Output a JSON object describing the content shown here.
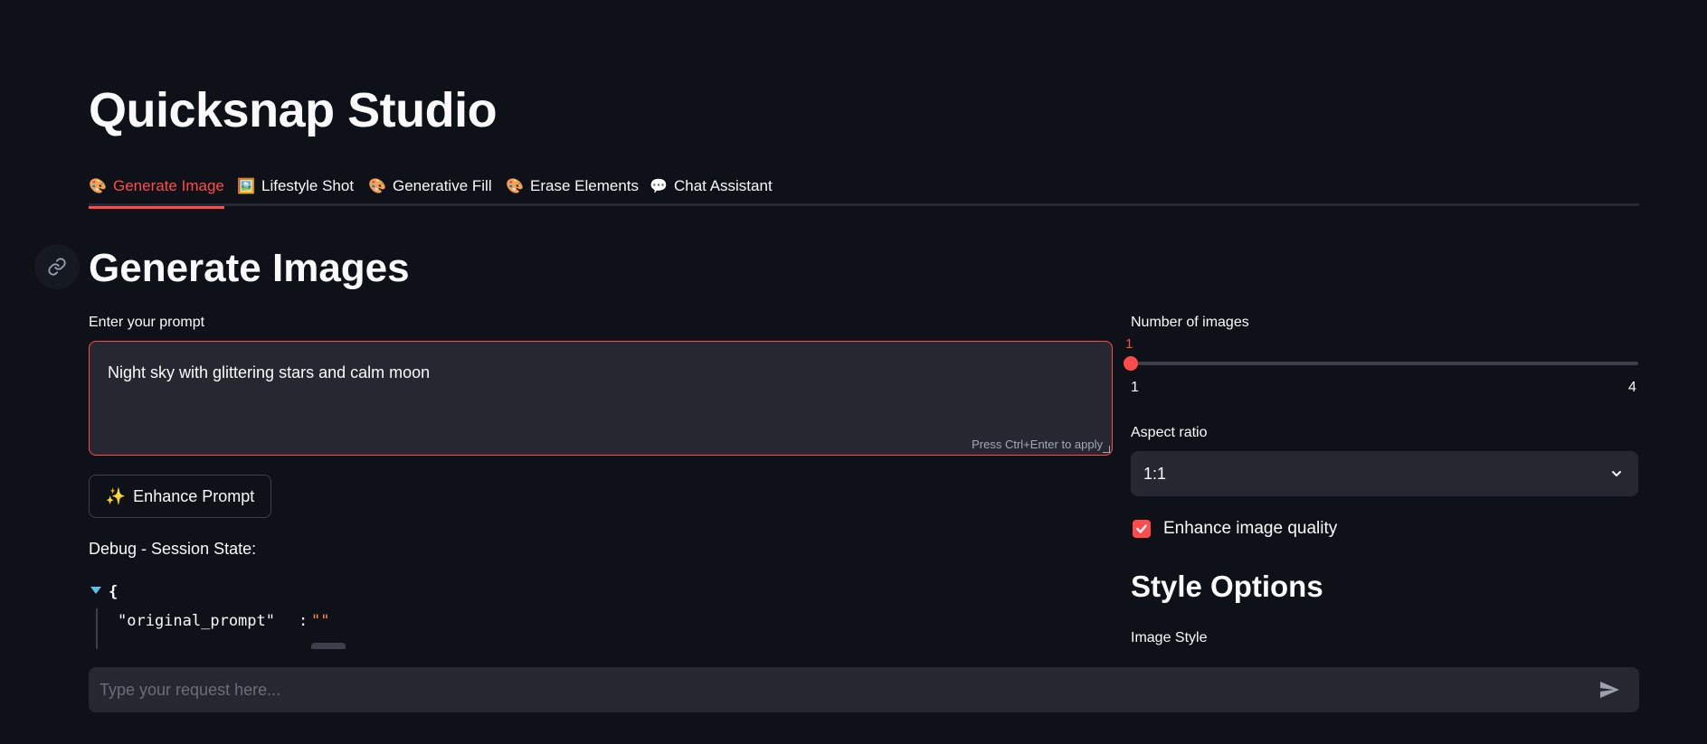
{
  "app": {
    "title": "Quicksnap Studio"
  },
  "tabs": [
    {
      "icon": "🎨",
      "label": "Generate Image",
      "active": true
    },
    {
      "icon": "🖼️",
      "label": "Lifestyle Shot"
    },
    {
      "icon": "🎨",
      "label": "Generative Fill"
    },
    {
      "icon": "🎨",
      "label": "Erase Elements"
    },
    {
      "icon": "💬",
      "label": "Chat Assistant"
    }
  ],
  "section": {
    "title": "Generate Images",
    "anchor_icon": "link-icon"
  },
  "prompt": {
    "label": "Enter your prompt",
    "value": "Night sky with glittering stars and calm moon",
    "hint": "Press Ctrl+Enter to apply"
  },
  "enhance_button": {
    "icon": "✨",
    "label": "Enhance Prompt"
  },
  "debug": {
    "label": "Debug - Session State:",
    "open_brace": "{",
    "key": "\"original_prompt\"",
    "colon": ":",
    "value": "\"\""
  },
  "num_images": {
    "label": "Number of images",
    "value": "1",
    "min": "1",
    "max": "4"
  },
  "aspect": {
    "label": "Aspect ratio",
    "value": "1:1"
  },
  "enhance_quality": {
    "label": "Enhance image quality",
    "checked": true
  },
  "style_options": {
    "heading": "Style Options",
    "image_style_label": "Image Style"
  },
  "chat": {
    "placeholder": "Type your request here..."
  },
  "colors": {
    "accent": "#ff4b4b",
    "background": "#0e1117",
    "surface": "#262730"
  }
}
